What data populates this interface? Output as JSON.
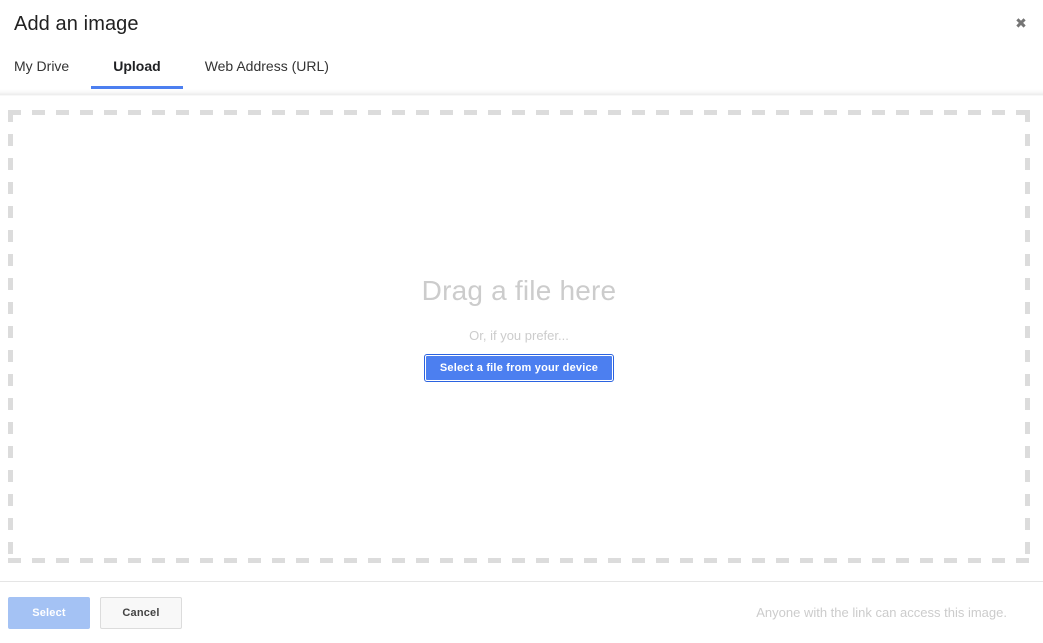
{
  "dialog": {
    "title": "Add an image",
    "close_icon": "close-icon",
    "close_glyph": "✖"
  },
  "tabs": [
    {
      "label": "My Drive",
      "active": false
    },
    {
      "label": "Upload",
      "active": true
    },
    {
      "label": "Web Address (URL)",
      "active": false
    }
  ],
  "dropzone": {
    "heading": "Drag a file here",
    "subtext": "Or, if you prefer...",
    "button_label": "Select a file from your device"
  },
  "footer": {
    "select_label": "Select",
    "cancel_label": "Cancel",
    "note": "Anyone with the link can access this image."
  },
  "colors": {
    "accent_blue": "#4c7ff0",
    "accent_blue_dark": "#2b63e0",
    "disabled_blue": "#a4c2f4",
    "muted_gray": "#cccccc",
    "dash_gray": "#dcdcdc",
    "border_gray": "#e5e5e5",
    "title_text": "#212121"
  }
}
